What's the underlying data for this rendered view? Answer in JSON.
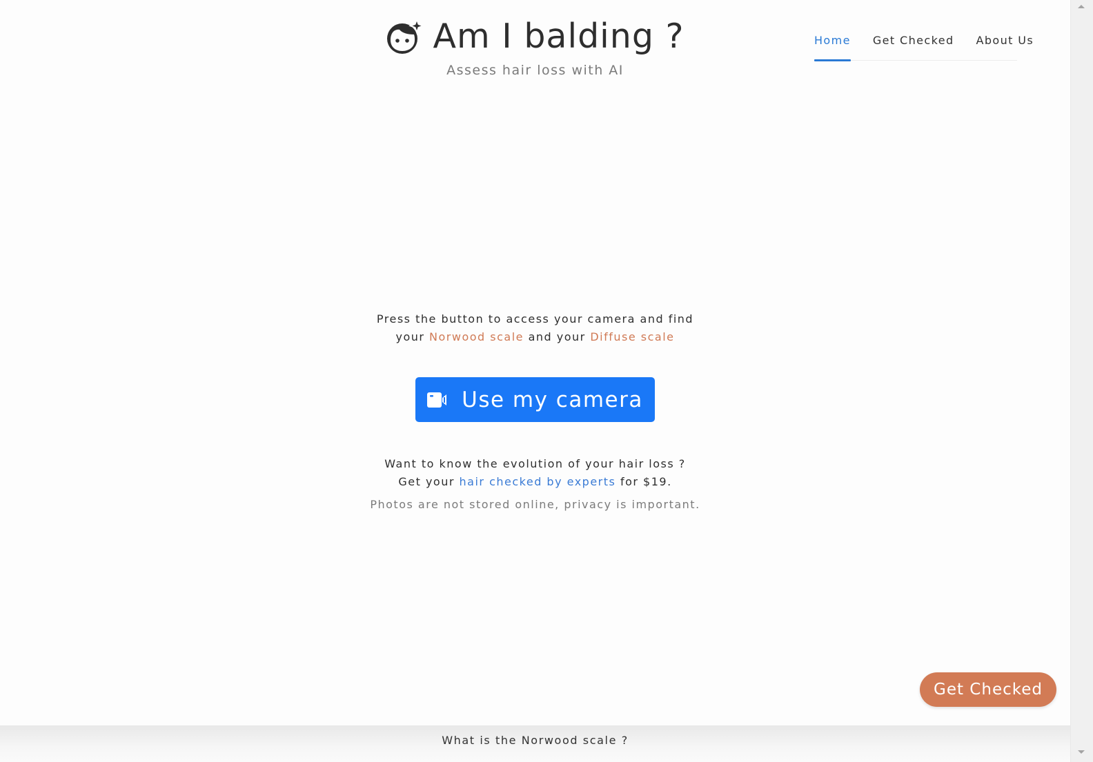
{
  "header": {
    "icon": "face-sparkle-icon",
    "title": "Am I balding ?",
    "subtitle": "Assess hair loss with AI"
  },
  "nav": {
    "items": [
      {
        "label": "Home",
        "active": true
      },
      {
        "label": "Get Checked",
        "active": false
      },
      {
        "label": "About Us",
        "active": false
      }
    ]
  },
  "intro": {
    "line1": "Press the button to access your camera and find",
    "line2_prefix": "your ",
    "norwood_link": "Norwood scale",
    "line2_middle": " and your ",
    "diffuse_link": "Diffuse scale"
  },
  "camera_button": {
    "icon": "video-camera-icon",
    "label": "Use my camera"
  },
  "evolution": {
    "line1": "Want to know the evolution of your hair loss ?",
    "line2_prefix": "Get your ",
    "experts_link": "hair checked by experts",
    "line2_suffix": " for $19."
  },
  "privacy_note": "Photos are not stored online, privacy is important.",
  "fab": {
    "label": "Get Checked"
  },
  "bottom_bar": {
    "label": "What is the Norwood scale ?"
  },
  "colors": {
    "primary_blue": "#1a78f7",
    "nav_active": "#2a7ad5",
    "accent_orange": "#d27b55",
    "link_blue": "#3a7bd5"
  }
}
